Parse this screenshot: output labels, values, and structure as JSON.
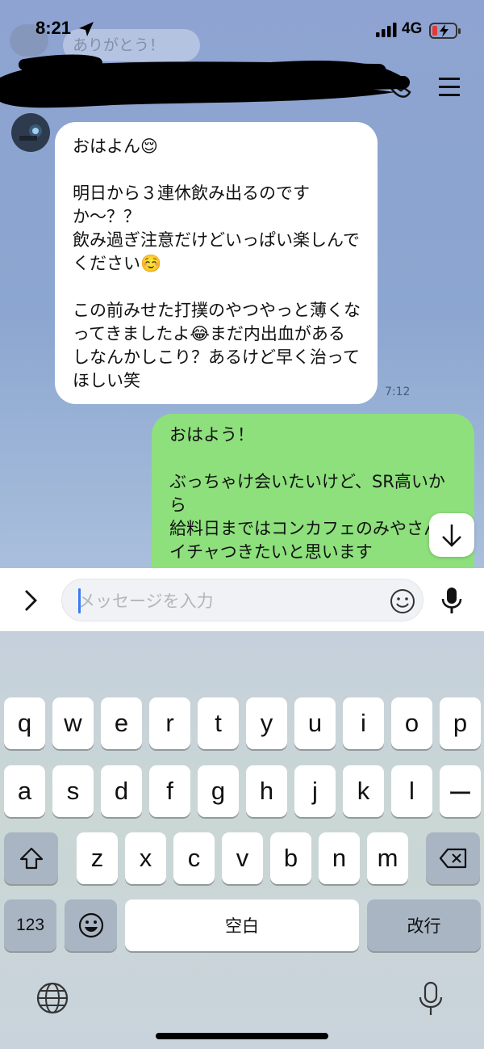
{
  "status_bar": {
    "time": "8:21",
    "network": "4G"
  },
  "background_chat": {
    "old_message": "ありがとう！"
  },
  "messages": [
    {
      "side": "incoming",
      "text": "おはよん😌\n\n明日から３連休飲み出るのですか〜？？\n飲み過ぎ注意だけどいっぱい楽しんでください☺️\n\nこの前みせた打撲のやつやっと薄くなってきましたよ😂まだ内出血があるしなんかしこり？あるけど早く治ってほしい笑",
      "time": "7:12"
    },
    {
      "side": "outgoing",
      "text": "おはよう！\n\nぶっちゃけ会いたいけど、SR高いから\n給料日まではコンカフェのみやさんとイチャつきたいと思います"
    }
  ],
  "input": {
    "placeholder": "メッセージを入力",
    "value": ""
  },
  "keyboard": {
    "row1": [
      "q",
      "w",
      "e",
      "r",
      "t",
      "y",
      "u",
      "i",
      "o",
      "p"
    ],
    "row2": [
      "a",
      "s",
      "d",
      "f",
      "g",
      "h",
      "j",
      "k",
      "l",
      "ー"
    ],
    "row3": [
      "z",
      "x",
      "c",
      "v",
      "b",
      "n",
      "m"
    ],
    "numbers_label": "123",
    "space_label": "空白",
    "return_label": "改行"
  },
  "icons": {
    "status": [
      "location-arrow-icon",
      "signal-icon",
      "battery-charging-icon"
    ],
    "header": [
      "back-icon",
      "phone-icon",
      "menu-icon"
    ],
    "input": [
      "chevron-right-icon",
      "emoji-icon",
      "mic-icon"
    ],
    "keyboard": [
      "shift-icon",
      "delete-icon",
      "emoji-keyboard-icon",
      "globe-icon",
      "dictation-icon"
    ]
  },
  "colors": {
    "chat_bg": "#8da4cf",
    "outgoing_bubble": "#8de07c",
    "incoming_bubble": "#ffffff",
    "caret": "#3a7bf5"
  }
}
